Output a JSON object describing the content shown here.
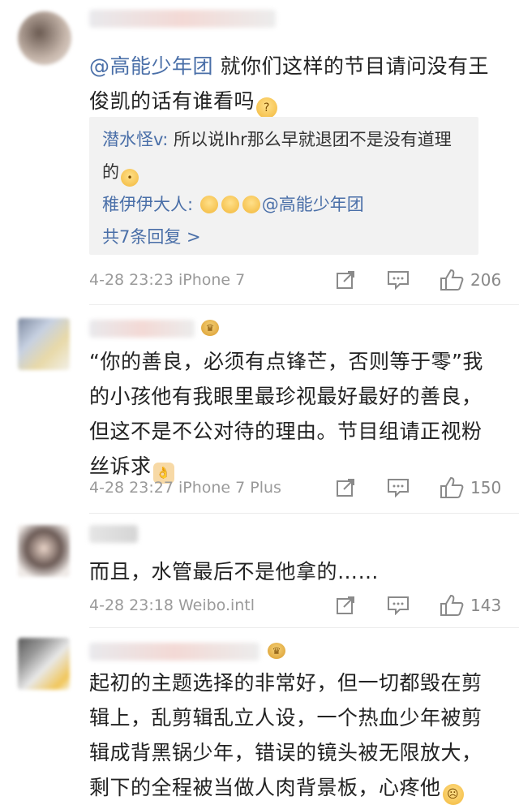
{
  "comments": [
    {
      "mention": "@高能少年团",
      "text": " 就你们这样的节目请问没有王俊凯的话有谁看吗",
      "emoji": "thinking-face-emoji",
      "replies": [
        {
          "user": "潜水怪v:",
          "text": " 所以说lhr那么早就退团不是没有道理的"
        },
        {
          "user": "稚伊伊大人:",
          "text": " ",
          "mention": "@高能少年团"
        }
      ],
      "more_replies": "共7条回复 >",
      "time": "4-28 23:23 iPhone 7",
      "likes": "206"
    },
    {
      "text": "“你的善良，必须有点锋芒，否则等于零”我的小孩他有我眼里最珍视最好最好的善良，但这不是不公对待的理由。节目组请正视粉丝诉求",
      "time": "4-28 23:27 iPhone 7 Plus",
      "likes": "150"
    },
    {
      "text": "而且，水管最后不是他拿的……",
      "time": "4-28 23:18 Weibo.intl",
      "likes": "143"
    },
    {
      "text": "起初的主题选择的非常好，但一切都毁在剪辑上，乱剪辑乱立人设，一个热血少年被剪辑成背黑锅少年，错误的镜头被无限放大，剩下的全程被当做人肉背景板，心疼他"
    }
  ],
  "colors": {
    "mention": "#4a6fa8",
    "meta": "#9a9a9a",
    "reply_bg": "#f2f2f2"
  }
}
